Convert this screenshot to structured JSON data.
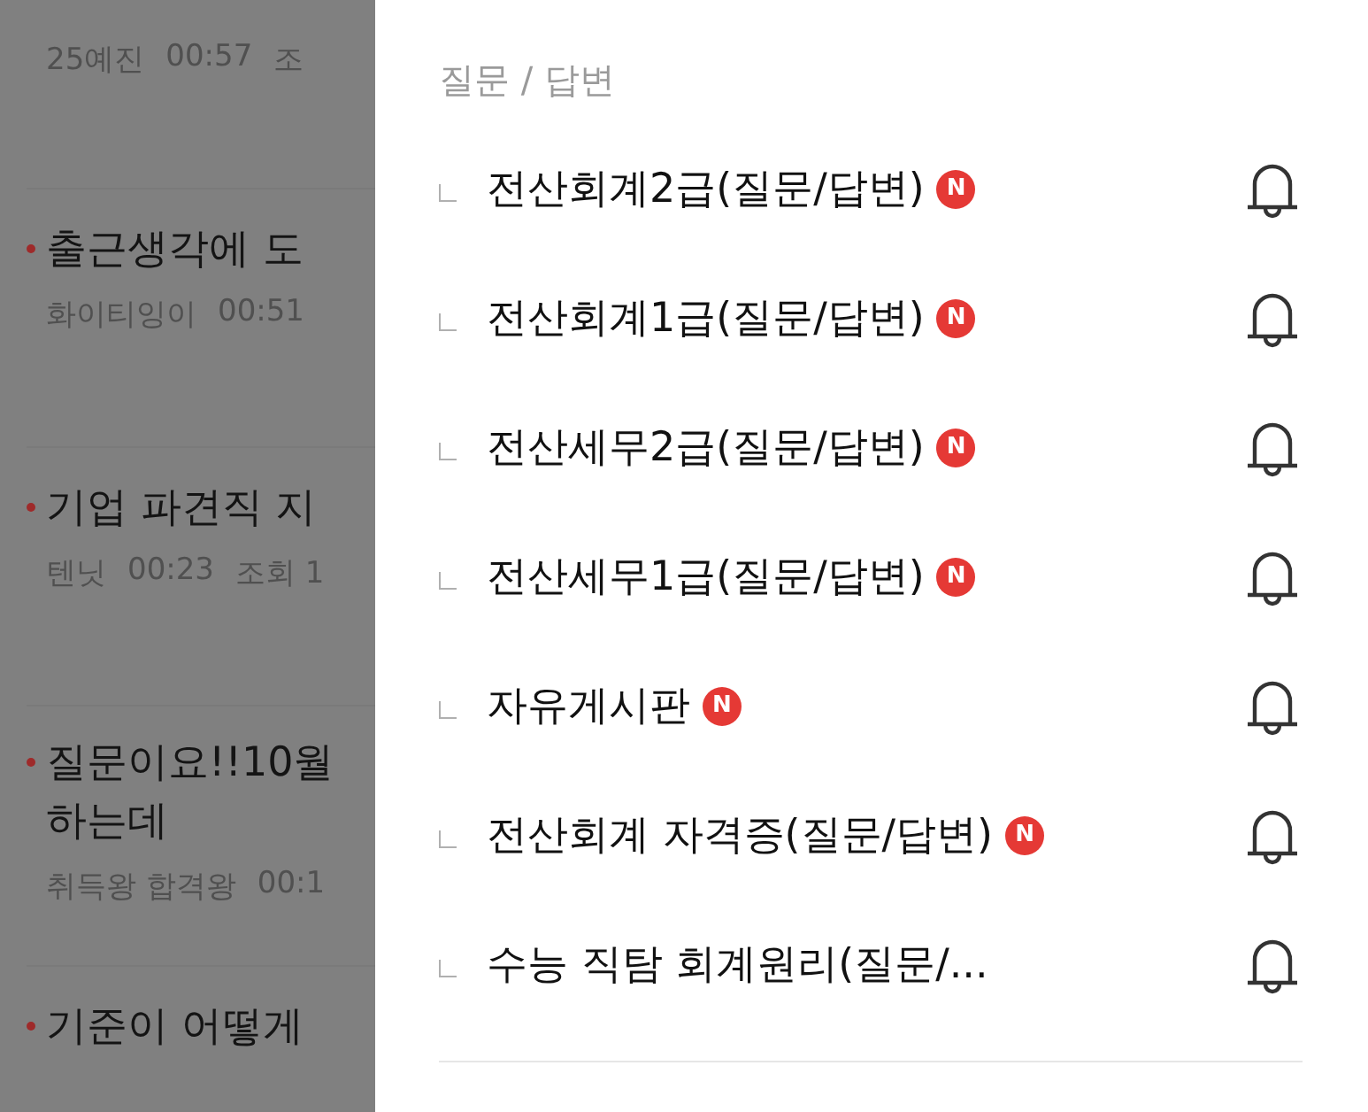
{
  "background_posts": [
    {
      "meta": [
        "25예진",
        "00:57",
        "조"
      ]
    },
    {
      "title_lines": [
        "출근생각에 도"
      ],
      "meta": [
        "화이티잉이",
        "00:51"
      ]
    },
    {
      "title_lines": [
        "기업 파견직 지"
      ],
      "meta": [
        "텐닛",
        "00:23",
        "조회 1"
      ]
    },
    {
      "title_lines": [
        "질문이요!!10월",
        "하는데"
      ],
      "meta": [
        "취득왕 합격왕",
        "00:1"
      ]
    },
    {
      "title_lines": [
        "기준이 어떻게"
      ]
    }
  ],
  "drawer": {
    "section_title": "질문 / 답변",
    "boards": [
      {
        "label": "전산회계2급(질문/답변)",
        "new": true,
        "new_badge": "N"
      },
      {
        "label": "전산회계1급(질문/답변)",
        "new": true,
        "new_badge": "N"
      },
      {
        "label": "전산세무2급(질문/답변)",
        "new": true,
        "new_badge": "N"
      },
      {
        "label": "전산세무1급(질문/답변)",
        "new": true,
        "new_badge": "N"
      },
      {
        "label": "자유게시판",
        "new": true,
        "new_badge": "N"
      },
      {
        "label": "전산회계 자격증(질문/답변)",
        "new": true,
        "new_badge": "N"
      },
      {
        "label": "수능 직탐 회계원리(질문/...",
        "new": false
      }
    ]
  }
}
